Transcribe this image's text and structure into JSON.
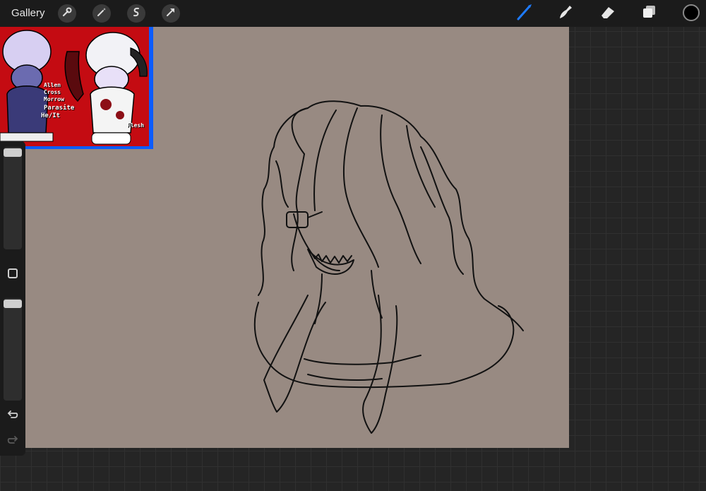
{
  "topbar": {
    "gallery_label": "Gallery",
    "left_tools": [
      "wrench-icon",
      "magic-wand-icon",
      "selection-icon",
      "transform-arrow-icon"
    ],
    "right_tools": [
      "brush-icon",
      "smudge-icon",
      "eraser-icon",
      "layers-icon"
    ],
    "active_tool": "brush-icon",
    "active_color": "#000000"
  },
  "reference_image": {
    "labels": [
      "Allen",
      "Cross",
      "Morrow",
      "Parasite",
      "He/It",
      "Flesh"
    ]
  },
  "sidebar": {
    "brush_size_level": 0.95,
    "opacity_level": 0.95
  },
  "colors": {
    "accent": "#1e7bff",
    "canvas_bg": "#988a82",
    "ref_bg": "#c40b12",
    "ref_border": "#0b5cff"
  }
}
